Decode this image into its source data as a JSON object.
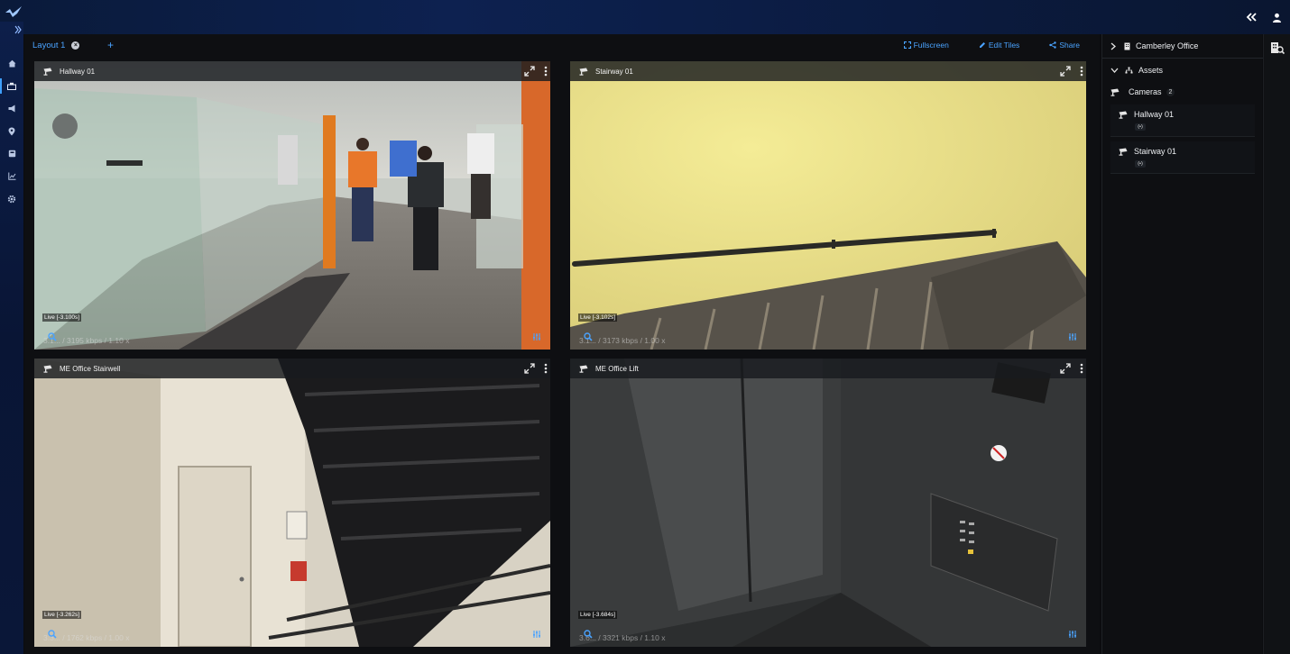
{
  "app": {
    "accent": "#4aa3ff"
  },
  "tabs": [
    {
      "label": "Layout 1"
    }
  ],
  "tab_add_label": "+",
  "toolbar": {
    "fullscreen": "Fullscreen",
    "edit_tiles": "Edit Tiles",
    "share": "Share"
  },
  "tiles": [
    {
      "name": "Hallway 01",
      "live": "Live [-3.100s]",
      "stats": "3.1... / 3195 kbps / 1.10 x"
    },
    {
      "name": "Stairway 01",
      "live": "Live [-3.102s]",
      "stats": "3.1... / 3173 kbps / 1.00 x"
    },
    {
      "name": "ME Office Stairwell",
      "live": "Live [-3.262s]",
      "stats": "3.3... / 1762 kbps / 1.00 x"
    },
    {
      "name": "ME Office Lift",
      "live": "Live [-3.684s]",
      "stats": "3.6... / 3321 kbps / 1.10 x"
    }
  ],
  "panel": {
    "site": "Camberley Office",
    "assets": "Assets",
    "cameras_label": "Cameras",
    "cameras_count": "2",
    "cameras": [
      {
        "name": "Hallway 01",
        "badge": "(•)"
      },
      {
        "name": "Stairway 01",
        "badge": "(•)"
      }
    ]
  }
}
